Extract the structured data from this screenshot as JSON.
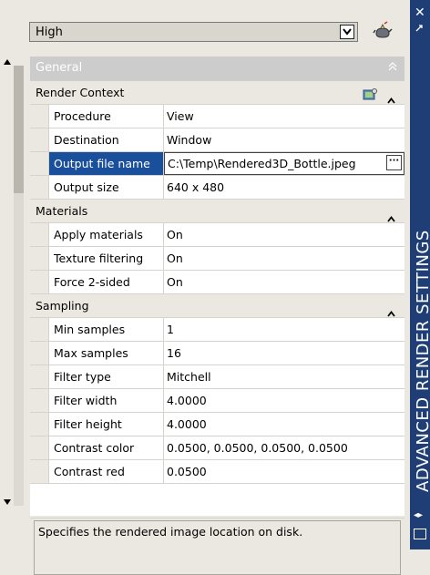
{
  "toolbar": {
    "preset_value": "High"
  },
  "palette": {
    "title": "ADVANCED RENDER SETTINGS"
  },
  "grid": {
    "header": "General",
    "categories": [
      {
        "label": "Render Context",
        "rows": [
          {
            "name": "Procedure",
            "value": "View"
          },
          {
            "name": "Destination",
            "value": "Window"
          },
          {
            "name": "Output file name",
            "value": "C:\\Temp\\Rendered3D_Bottle.jpeg"
          },
          {
            "name": "Output size",
            "value": "640 x 480"
          }
        ]
      },
      {
        "label": "Materials",
        "rows": [
          {
            "name": "Apply materials",
            "value": "On"
          },
          {
            "name": "Texture filtering",
            "value": "On"
          },
          {
            "name": "Force 2-sided",
            "value": "On"
          }
        ]
      },
      {
        "label": "Sampling",
        "rows": [
          {
            "name": "Min samples",
            "value": "1"
          },
          {
            "name": "Max samples",
            "value": "16"
          },
          {
            "name": "Filter type",
            "value": "Mitchell"
          },
          {
            "name": "Filter width",
            "value": "4.0000"
          },
          {
            "name": "Filter height",
            "value": "4.0000"
          },
          {
            "name": "Contrast color",
            "value": "0.0500, 0.0500, 0.0500, 0.0500"
          },
          {
            "name": "Contrast red",
            "value": "0.0500"
          }
        ]
      }
    ]
  },
  "description": "Specifies the rendered image location on disk.",
  "colors": {
    "selection": "#1a4f9c",
    "palette_bar": "#1f3e76",
    "header_bg": "#cccccc"
  }
}
